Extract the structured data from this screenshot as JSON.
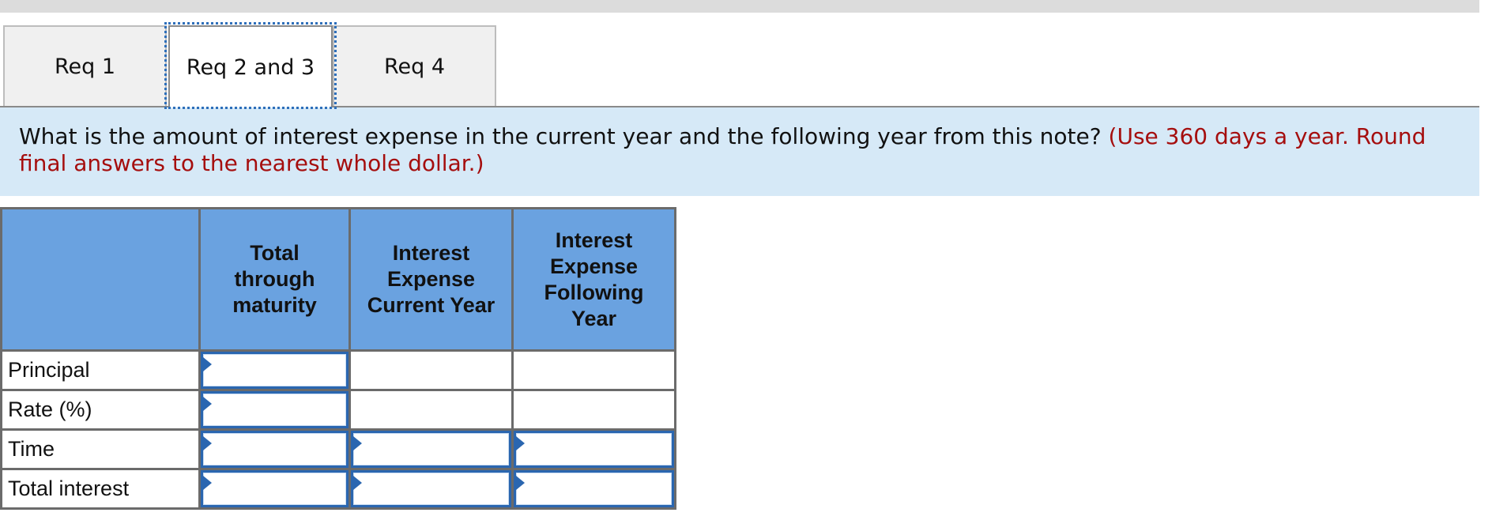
{
  "tabs": [
    {
      "label": "Req 1",
      "active": false
    },
    {
      "label": "Req 2 and 3",
      "active": true
    },
    {
      "label": "Req 4",
      "active": false
    }
  ],
  "question": {
    "text": "What is the amount of interest expense in the current year and the following year from this note?",
    "instruction": "(Use 360 days a year. Round final answers to the nearest whole dollar.)"
  },
  "colors": {
    "header_bg": "#6aa2e0",
    "info_bg": "#d6e9f7",
    "instruction_text": "#a50e0e",
    "input_border": "#2a66b0"
  },
  "table": {
    "columns": [
      "",
      "Total through maturity",
      "Interest Expense Current Year",
      "Interest Expense Following Year"
    ],
    "column_lines": [
      [],
      [
        "Total",
        "through",
        "maturity"
      ],
      [
        "Interest",
        "Expense",
        "Current Year"
      ],
      [
        "Interest",
        "Expense",
        "Following",
        "Year"
      ]
    ],
    "rows": [
      {
        "label": "Principal",
        "cells": [
          {
            "input": true,
            "value": ""
          },
          {
            "input": false,
            "value": ""
          },
          {
            "input": false,
            "value": ""
          }
        ]
      },
      {
        "label": "Rate (%)",
        "cells": [
          {
            "input": true,
            "value": ""
          },
          {
            "input": false,
            "value": ""
          },
          {
            "input": false,
            "value": ""
          }
        ]
      },
      {
        "label": "Time",
        "cells": [
          {
            "input": true,
            "value": ""
          },
          {
            "input": true,
            "value": ""
          },
          {
            "input": true,
            "value": ""
          }
        ]
      },
      {
        "label": "Total interest",
        "cells": [
          {
            "input": true,
            "value": ""
          },
          {
            "input": true,
            "value": ""
          },
          {
            "input": true,
            "value": ""
          }
        ]
      }
    ]
  }
}
